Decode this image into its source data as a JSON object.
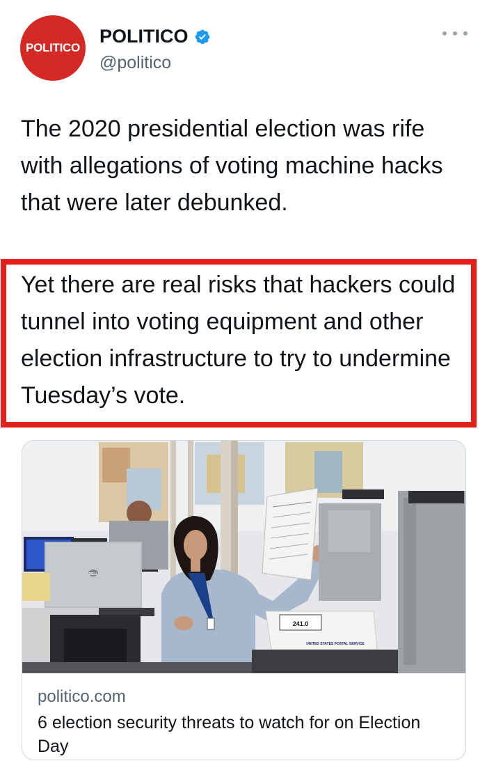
{
  "author": {
    "avatar_label": "POLITICO",
    "display_name": "POLITICO",
    "handle": "@politico",
    "verified": true,
    "icons": {
      "verified": "verified-badge-icon",
      "more": "more-options-icon"
    }
  },
  "tweet": {
    "paragraph1": "The 2020 presidential election was rife with allegations of voting machine hacks that were later debunked.",
    "paragraph2": "Yet there are real risks that hackers could tunnel into voting equipment and other election infrastructure to try to undermine Tuesday’s vote."
  },
  "card": {
    "domain": "politico.com",
    "title": "6 election security threats to watch for on Election Day",
    "photo": {
      "laptop_brand": "DELL",
      "bin_number": "241.0",
      "bin_label": "UNITED STATES POSTAL SERVICE"
    }
  },
  "colors": {
    "brand_red": "#d32a26",
    "highlight_red": "#e3201b",
    "verified_blue": "#1d9bf0",
    "secondary_text": "#536471"
  }
}
